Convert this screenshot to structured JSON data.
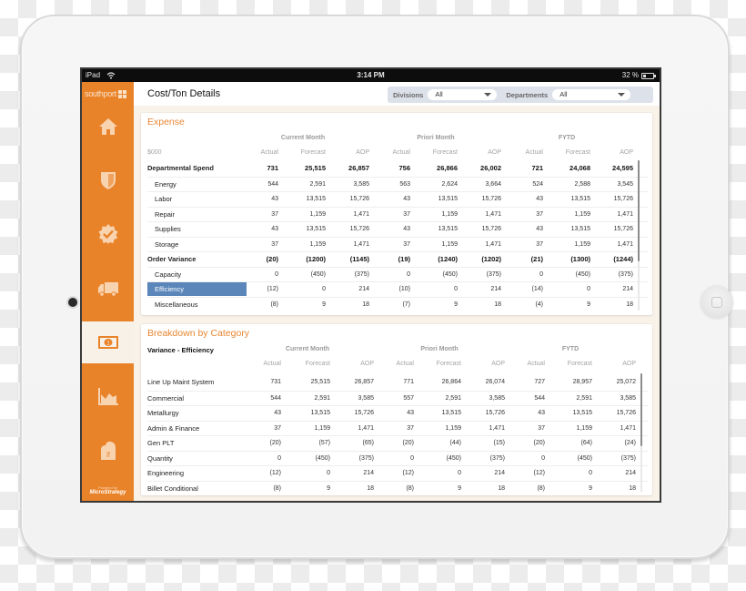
{
  "device": {
    "status_bar": {
      "carrier": "iPad",
      "time": "3:14 PM",
      "battery": "32 %"
    }
  },
  "sidebar": {
    "logo": "southport",
    "items": [
      {
        "name": "home",
        "icon": "home-icon",
        "active": false
      },
      {
        "name": "safety",
        "icon": "shield-icon",
        "active": false
      },
      {
        "name": "quality",
        "icon": "badge-check-icon",
        "active": false
      },
      {
        "name": "delivery",
        "icon": "truck-icon",
        "active": false
      },
      {
        "name": "cost",
        "icon": "money-icon",
        "active": true
      },
      {
        "name": "trends",
        "icon": "area-chart-icon",
        "active": false
      },
      {
        "name": "what-if",
        "icon": "what-if-cloud-icon",
        "active": false
      }
    ],
    "powered_by": "Powered by",
    "powered_brand": "MicroStrategy"
  },
  "header": {
    "title": "Cost/Ton Details",
    "filters": [
      {
        "label": "Divisions",
        "value": "All"
      },
      {
        "label": "Departments",
        "value": "All"
      }
    ]
  },
  "expense": {
    "title": "Expense",
    "units_label": "$000",
    "groups": [
      "Current Month",
      "Priori Month",
      "FYTD"
    ],
    "subheaders": [
      "Actual",
      "Forecast",
      "AOP"
    ],
    "rows": [
      {
        "label": "Departmental Spend",
        "bold": true,
        "indent": false,
        "values": [
          "731",
          "25,515",
          "26,857",
          "756",
          "26,866",
          "26,002",
          "721",
          "24,068",
          "24,595"
        ]
      },
      {
        "label": "Energy",
        "bold": false,
        "indent": true,
        "values": [
          "544",
          "2,591",
          "3,585",
          "563",
          "2,624",
          "3,664",
          "524",
          "2,588",
          "3,545"
        ]
      },
      {
        "label": "Labor",
        "bold": false,
        "indent": true,
        "values": [
          "43",
          "13,515",
          "15,726",
          "43",
          "13,515",
          "15,726",
          "43",
          "13,515",
          "15,726"
        ]
      },
      {
        "label": "Repair",
        "bold": false,
        "indent": true,
        "values": [
          "37",
          "1,159",
          "1,471",
          "37",
          "1,159",
          "1,471",
          "37",
          "1,159",
          "1,471"
        ]
      },
      {
        "label": "Supplies",
        "bold": false,
        "indent": true,
        "values": [
          "43",
          "13,515",
          "15,726",
          "43",
          "13,515",
          "15,726",
          "43",
          "13,515",
          "15,726"
        ]
      },
      {
        "label": "Storage",
        "bold": false,
        "indent": true,
        "values": [
          "37",
          "1,159",
          "1,471",
          "37",
          "1,159",
          "1,471",
          "37",
          "1,159",
          "1,471"
        ]
      },
      {
        "label": "Order Variance",
        "bold": true,
        "indent": false,
        "values": [
          "(20)",
          "(1200)",
          "(1145)",
          "(19)",
          "(1240)",
          "(1202)",
          "(21)",
          "(1300)",
          "(1244)"
        ]
      },
      {
        "label": "Capacity",
        "bold": false,
        "indent": true,
        "values": [
          "0",
          "(450)",
          "(375)",
          "0",
          "(450)",
          "(375)",
          "0",
          "(450)",
          "(375)"
        ]
      },
      {
        "label": "Efficiency",
        "bold": false,
        "indent": true,
        "selected": true,
        "values": [
          "(12)",
          "0",
          "214",
          "(10)",
          "0",
          "214",
          "(14)",
          "0",
          "214"
        ]
      },
      {
        "label": "Miscellaneous",
        "bold": false,
        "indent": true,
        "values": [
          "(8)",
          "9",
          "18",
          "(7)",
          "9",
          "18",
          "(4)",
          "9",
          "18"
        ]
      }
    ]
  },
  "breakdown": {
    "title": "Breakdown by Category",
    "table_label": "Variance - Efficiency",
    "groups": [
      "Current Month",
      "Priori Month",
      "FYTD"
    ],
    "subheaders": [
      "Actual",
      "Forecast",
      "AOP"
    ],
    "rows": [
      {
        "label": "Line Up Maint System",
        "values": [
          "731",
          "25,515",
          "26,857",
          "771",
          "26,864",
          "26,074",
          "727",
          "28,957",
          "25,072"
        ]
      },
      {
        "label": "Commercial",
        "values": [
          "544",
          "2,591",
          "3,585",
          "557",
          "2,591",
          "3,585",
          "544",
          "2,591",
          "3,585"
        ]
      },
      {
        "label": "Metallurgy",
        "values": [
          "43",
          "13,515",
          "15,726",
          "43",
          "13,515",
          "15,726",
          "43",
          "13,515",
          "15,726"
        ]
      },
      {
        "label": "Admin & Finance",
        "values": [
          "37",
          "1,159",
          "1,471",
          "37",
          "1,159",
          "1,471",
          "37",
          "1,159",
          "1,471"
        ]
      },
      {
        "label": "Gen PLT",
        "values": [
          "(20)",
          "(57)",
          "(65)",
          "(20)",
          "(44)",
          "(15)",
          "(20)",
          "(64)",
          "(24)"
        ]
      },
      {
        "label": "Quantity",
        "values": [
          "0",
          "(450)",
          "(375)",
          "0",
          "(450)",
          "(375)",
          "0",
          "(450)",
          "(375)"
        ]
      },
      {
        "label": "Engineering",
        "values": [
          "(12)",
          "0",
          "214",
          "(12)",
          "0",
          "214",
          "(12)",
          "0",
          "214"
        ]
      },
      {
        "label": "Billet Conditional",
        "values": [
          "(8)",
          "9",
          "18",
          "(8)",
          "9",
          "18",
          "(8)",
          "9",
          "18"
        ]
      }
    ]
  },
  "colors": {
    "accent_orange": "#e9832a",
    "selected_row": "#5a86ba",
    "panel_background": "#f9f2e8"
  }
}
